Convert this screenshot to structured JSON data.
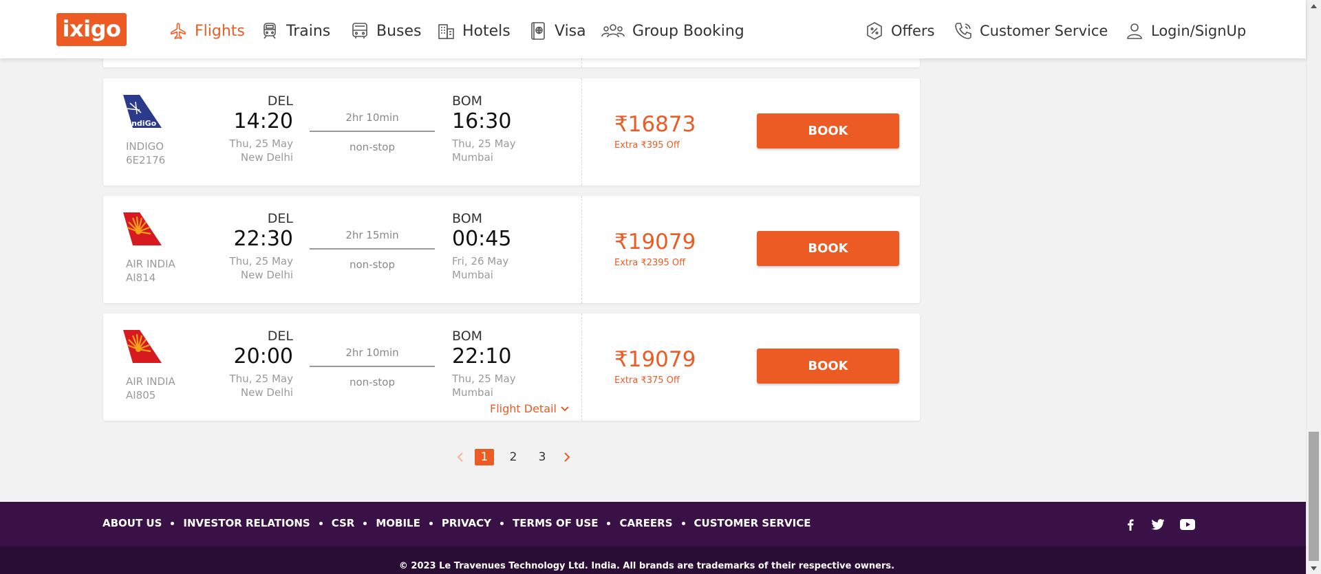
{
  "brand": {
    "logo_text": "ixigo",
    "accent": "#ec5b24"
  },
  "nav": [
    {
      "label": "Flights",
      "icon": "plane-icon",
      "active": true
    },
    {
      "label": "Trains",
      "icon": "train-icon"
    },
    {
      "label": "Buses",
      "icon": "bus-icon"
    },
    {
      "label": "Hotels",
      "icon": "hotel-icon"
    },
    {
      "label": "Visa",
      "icon": "passport-icon"
    },
    {
      "label": "Group Booking",
      "icon": "group-icon"
    }
  ],
  "right_nav": {
    "offers": "Offers",
    "customer_service": "Customer Service",
    "login": "Login/SignUp"
  },
  "flights": [
    {
      "airline": "INDIGO",
      "code": "6E2176",
      "logo": "indigo-logo",
      "dep_code": "DEL",
      "dep_time": "14:20",
      "dep_date": "Thu, 25 May",
      "dep_city": "New Delhi",
      "duration": "2hr 10min",
      "stops": "non-stop",
      "arr_code": "BOM",
      "arr_time": "16:30",
      "arr_date": "Thu, 25 May",
      "arr_city": "Mumbai",
      "price": "₹16873",
      "extra": "Extra ₹395 Off",
      "book": "BOOK"
    },
    {
      "airline": "AIR INDIA",
      "code": "AI814",
      "logo": "airindia-logo",
      "dep_code": "DEL",
      "dep_time": "22:30",
      "dep_date": "Thu, 25 May",
      "dep_city": "New Delhi",
      "duration": "2hr 15min",
      "stops": "non-stop",
      "arr_code": "BOM",
      "arr_time": "00:45",
      "arr_date": "Fri, 26 May",
      "arr_city": "Mumbai",
      "price": "₹19079",
      "extra": "Extra ₹2395 Off",
      "book": "BOOK"
    },
    {
      "airline": "AIR INDIA",
      "code": "AI805",
      "logo": "airindia-logo",
      "dep_code": "DEL",
      "dep_time": "20:00",
      "dep_date": "Thu, 25 May",
      "dep_city": "New Delhi",
      "duration": "2hr 10min",
      "stops": "non-stop",
      "arr_code": "BOM",
      "arr_time": "22:10",
      "arr_date": "Thu, 25 May",
      "arr_city": "Mumbai",
      "price": "₹19079",
      "extra": "Extra ₹375 Off",
      "book": "BOOK",
      "flight_detail": "Flight Detail"
    }
  ],
  "pagination": {
    "pages": [
      "1",
      "2",
      "3"
    ],
    "current": "1"
  },
  "footer": {
    "links": [
      "ABOUT US",
      "INVESTOR RELATIONS",
      "CSR",
      "MOBILE",
      "PRIVACY",
      "TERMS OF USE",
      "CAREERS",
      "CUSTOMER SERVICE"
    ],
    "social": [
      "facebook-icon",
      "twitter-icon",
      "youtube-icon"
    ],
    "copyright": "© 2023 Le Travenues Technology Ltd. India. All brands are trademarks of their respective owners."
  }
}
